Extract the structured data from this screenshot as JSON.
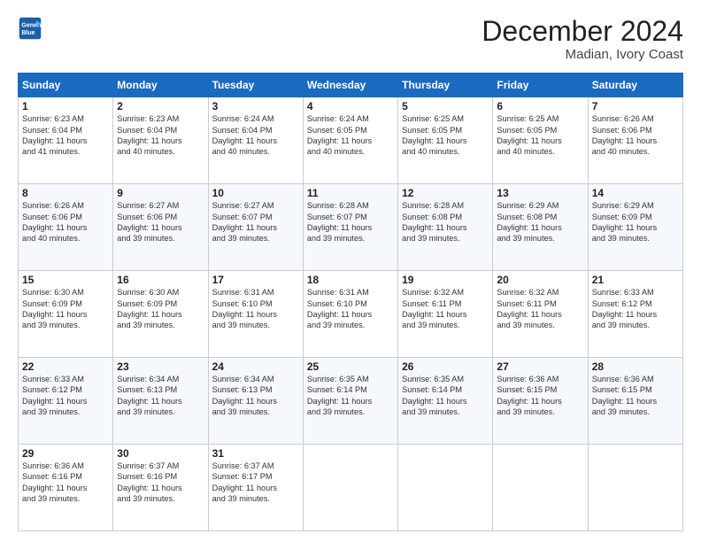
{
  "logo": {
    "line1": "General",
    "line2": "Blue"
  },
  "title": "December 2024",
  "subtitle": "Madian, Ivory Coast",
  "days_header": [
    "Sunday",
    "Monday",
    "Tuesday",
    "Wednesday",
    "Thursday",
    "Friday",
    "Saturday"
  ],
  "weeks": [
    [
      {
        "day": "1",
        "text": "Sunrise: 6:23 AM\nSunset: 6:04 PM\nDaylight: 11 hours\nand 41 minutes."
      },
      {
        "day": "2",
        "text": "Sunrise: 6:23 AM\nSunset: 6:04 PM\nDaylight: 11 hours\nand 40 minutes."
      },
      {
        "day": "3",
        "text": "Sunrise: 6:24 AM\nSunset: 6:04 PM\nDaylight: 11 hours\nand 40 minutes."
      },
      {
        "day": "4",
        "text": "Sunrise: 6:24 AM\nSunset: 6:05 PM\nDaylight: 11 hours\nand 40 minutes."
      },
      {
        "day": "5",
        "text": "Sunrise: 6:25 AM\nSunset: 6:05 PM\nDaylight: 11 hours\nand 40 minutes."
      },
      {
        "day": "6",
        "text": "Sunrise: 6:25 AM\nSunset: 6:05 PM\nDaylight: 11 hours\nand 40 minutes."
      },
      {
        "day": "7",
        "text": "Sunrise: 6:26 AM\nSunset: 6:06 PM\nDaylight: 11 hours\nand 40 minutes."
      }
    ],
    [
      {
        "day": "8",
        "text": "Sunrise: 6:26 AM\nSunset: 6:06 PM\nDaylight: 11 hours\nand 40 minutes."
      },
      {
        "day": "9",
        "text": "Sunrise: 6:27 AM\nSunset: 6:06 PM\nDaylight: 11 hours\nand 39 minutes."
      },
      {
        "day": "10",
        "text": "Sunrise: 6:27 AM\nSunset: 6:07 PM\nDaylight: 11 hours\nand 39 minutes."
      },
      {
        "day": "11",
        "text": "Sunrise: 6:28 AM\nSunset: 6:07 PM\nDaylight: 11 hours\nand 39 minutes."
      },
      {
        "day": "12",
        "text": "Sunrise: 6:28 AM\nSunset: 6:08 PM\nDaylight: 11 hours\nand 39 minutes."
      },
      {
        "day": "13",
        "text": "Sunrise: 6:29 AM\nSunset: 6:08 PM\nDaylight: 11 hours\nand 39 minutes."
      },
      {
        "day": "14",
        "text": "Sunrise: 6:29 AM\nSunset: 6:09 PM\nDaylight: 11 hours\nand 39 minutes."
      }
    ],
    [
      {
        "day": "15",
        "text": "Sunrise: 6:30 AM\nSunset: 6:09 PM\nDaylight: 11 hours\nand 39 minutes."
      },
      {
        "day": "16",
        "text": "Sunrise: 6:30 AM\nSunset: 6:09 PM\nDaylight: 11 hours\nand 39 minutes."
      },
      {
        "day": "17",
        "text": "Sunrise: 6:31 AM\nSunset: 6:10 PM\nDaylight: 11 hours\nand 39 minutes."
      },
      {
        "day": "18",
        "text": "Sunrise: 6:31 AM\nSunset: 6:10 PM\nDaylight: 11 hours\nand 39 minutes."
      },
      {
        "day": "19",
        "text": "Sunrise: 6:32 AM\nSunset: 6:11 PM\nDaylight: 11 hours\nand 39 minutes."
      },
      {
        "day": "20",
        "text": "Sunrise: 6:32 AM\nSunset: 6:11 PM\nDaylight: 11 hours\nand 39 minutes."
      },
      {
        "day": "21",
        "text": "Sunrise: 6:33 AM\nSunset: 6:12 PM\nDaylight: 11 hours\nand 39 minutes."
      }
    ],
    [
      {
        "day": "22",
        "text": "Sunrise: 6:33 AM\nSunset: 6:12 PM\nDaylight: 11 hours\nand 39 minutes."
      },
      {
        "day": "23",
        "text": "Sunrise: 6:34 AM\nSunset: 6:13 PM\nDaylight: 11 hours\nand 39 minutes."
      },
      {
        "day": "24",
        "text": "Sunrise: 6:34 AM\nSunset: 6:13 PM\nDaylight: 11 hours\nand 39 minutes."
      },
      {
        "day": "25",
        "text": "Sunrise: 6:35 AM\nSunset: 6:14 PM\nDaylight: 11 hours\nand 39 minutes."
      },
      {
        "day": "26",
        "text": "Sunrise: 6:35 AM\nSunset: 6:14 PM\nDaylight: 11 hours\nand 39 minutes."
      },
      {
        "day": "27",
        "text": "Sunrise: 6:36 AM\nSunset: 6:15 PM\nDaylight: 11 hours\nand 39 minutes."
      },
      {
        "day": "28",
        "text": "Sunrise: 6:36 AM\nSunset: 6:15 PM\nDaylight: 11 hours\nand 39 minutes."
      }
    ],
    [
      {
        "day": "29",
        "text": "Sunrise: 6:36 AM\nSunset: 6:16 PM\nDaylight: 11 hours\nand 39 minutes."
      },
      {
        "day": "30",
        "text": "Sunrise: 6:37 AM\nSunset: 6:16 PM\nDaylight: 11 hours\nand 39 minutes."
      },
      {
        "day": "31",
        "text": "Sunrise: 6:37 AM\nSunset: 6:17 PM\nDaylight: 11 hours\nand 39 minutes."
      },
      {
        "day": "",
        "text": ""
      },
      {
        "day": "",
        "text": ""
      },
      {
        "day": "",
        "text": ""
      },
      {
        "day": "",
        "text": ""
      }
    ]
  ]
}
